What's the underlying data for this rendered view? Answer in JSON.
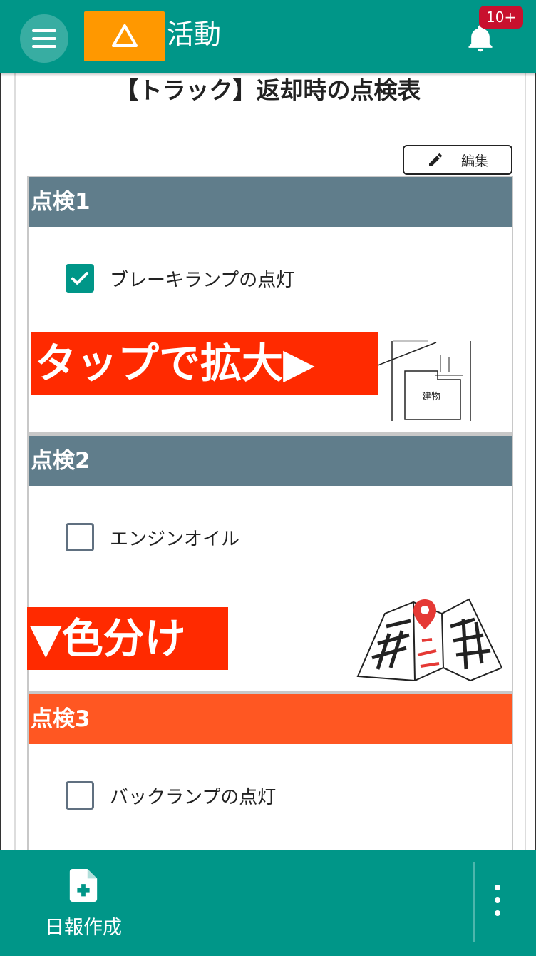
{
  "header": {
    "title": "活動",
    "notification_badge": "10+",
    "icons": [
      "menu-icon",
      "warning-triangle-icon",
      "bell-icon"
    ]
  },
  "page": {
    "title": "【トラック】返却時の点検表",
    "edit_label": "編集"
  },
  "sections": [
    {
      "title": "点検1",
      "item": "ブレーキランプの点灯",
      "checked": true,
      "color": "#607d8b"
    },
    {
      "title": "点検2",
      "item": "エンジンオイル",
      "checked": false,
      "color": "#607d8b"
    },
    {
      "title": "点検3",
      "item": "バックランプの点灯",
      "checked": false,
      "color": "#ff5722"
    }
  ],
  "overlays": {
    "tap_zoom": "タップで拡大▶",
    "color_coding": "▼色分け",
    "floorplan_label": "建物"
  },
  "bottom_bar": {
    "create_report": "日報作成"
  },
  "colors": {
    "primary": "#009688",
    "accent": "#ff9800",
    "badge": "#c8102e",
    "section_gray": "#607d8b",
    "section_orange": "#ff5722",
    "overlay_red": "#ff2a00"
  }
}
